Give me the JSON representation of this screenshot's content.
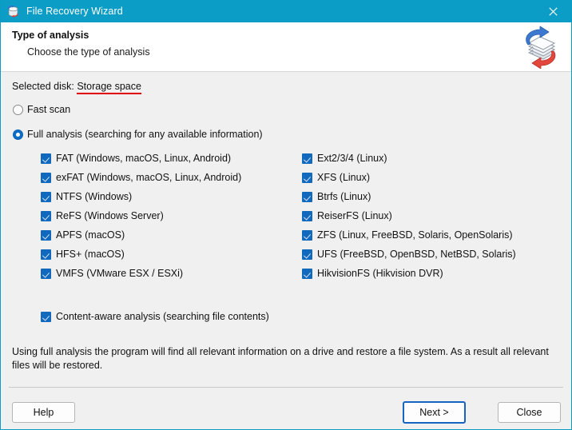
{
  "window": {
    "title": "File Recovery Wizard",
    "app_icon": "disk-recovery-icon",
    "close_icon": "close-icon",
    "titlebar_color": "#0c9dc6"
  },
  "header": {
    "title": "Type of analysis",
    "subtitle": "Choose the type of analysis",
    "logo_icon": "disk-recovery-logo"
  },
  "selected_disk": {
    "label": "Selected disk:",
    "value": "Storage space",
    "underline_color": "#e00000"
  },
  "scan_modes": [
    {
      "label": "Fast scan",
      "checked": false
    },
    {
      "label": "Full analysis (searching for any available information)",
      "checked": true
    }
  ],
  "filesystems_left": [
    {
      "label": "FAT (Windows, macOS, Linux, Android)",
      "checked": true
    },
    {
      "label": "exFAT (Windows, macOS, Linux, Android)",
      "checked": true
    },
    {
      "label": "NTFS (Windows)",
      "checked": true
    },
    {
      "label": "ReFS (Windows Server)",
      "checked": true
    },
    {
      "label": "APFS (macOS)",
      "checked": true
    },
    {
      "label": "HFS+ (macOS)",
      "checked": true
    },
    {
      "label": "VMFS (VMware ESX / ESXi)",
      "checked": true
    }
  ],
  "filesystems_right": [
    {
      "label": "Ext2/3/4 (Linux)",
      "checked": true
    },
    {
      "label": "XFS (Linux)",
      "checked": true
    },
    {
      "label": "Btrfs (Linux)",
      "checked": true
    },
    {
      "label": "ReiserFS (Linux)",
      "checked": true
    },
    {
      "label": "ZFS (Linux, FreeBSD, Solaris, OpenSolaris)",
      "checked": true
    },
    {
      "label": "UFS (FreeBSD, OpenBSD, NetBSD, Solaris)",
      "checked": true
    },
    {
      "label": "HikvisionFS (Hikvision DVR)",
      "checked": true
    }
  ],
  "content_aware": {
    "label": "Content-aware analysis (searching file contents)",
    "checked": true
  },
  "note": "Using full analysis the program will find all relevant information on a drive and restore a file system. As a result all relevant files will be restored.",
  "footer": {
    "help_label": "Help",
    "next_label": "Next >",
    "close_label": "Close"
  }
}
